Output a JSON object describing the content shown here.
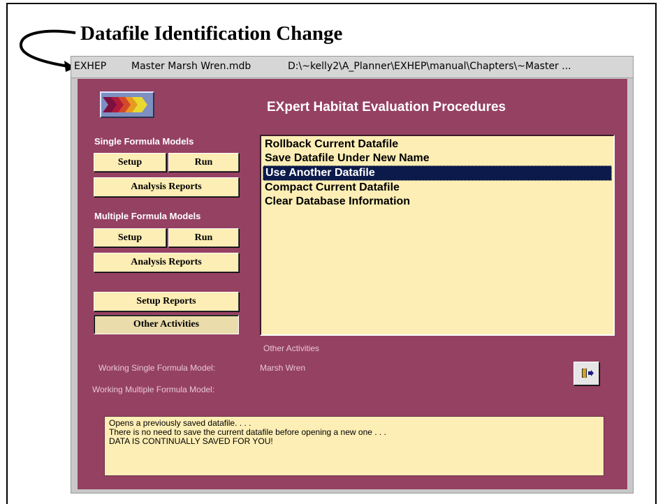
{
  "heading": "Datafile Identification Change",
  "titlebar": {
    "app": "EXHEP",
    "file": "Master Marsh Wren.mdb",
    "path": "D:\\~kelly2\\A_Planner\\EXHEP\\manual\\Chapters\\~Master ..."
  },
  "app_title": "EXpert Habitat Evaluation Procedures",
  "logo": {
    "icon": "multicolor-arrows-logo"
  },
  "single": {
    "label": "Single Formula Models",
    "setup": "Setup",
    "run": "Run",
    "reports": "Analysis Reports"
  },
  "multiple": {
    "label": "Multiple Formula Models",
    "setup": "Setup",
    "run": "Run",
    "reports": "Analysis Reports"
  },
  "setup_reports": "Setup Reports",
  "other_activities": "Other Activities",
  "list": {
    "items": [
      "Rollback Current Datafile",
      "Save Datafile Under New Name",
      "Use Another Datafile",
      "Compact Current Datafile",
      "Clear Database Information"
    ],
    "selected_index": 2,
    "caption": "Other Activities"
  },
  "working": {
    "single_label": "Working Single Formula Model:",
    "single_value": "Marsh Wren",
    "multiple_label": "Working Multiple Formula Model:",
    "multiple_value": ""
  },
  "exit_button": {
    "icon": "exit-door-icon"
  },
  "description": [
    "Opens a previously saved datafile. . . .",
    "There is no need to save the current datafile before opening a new one . . .",
    "DATA IS CONTINUALLY SAVED FOR YOU!"
  ],
  "colors": {
    "form_background": "#954162",
    "button_fill": "#fdeeb5",
    "selection": "#0b1a4a"
  }
}
